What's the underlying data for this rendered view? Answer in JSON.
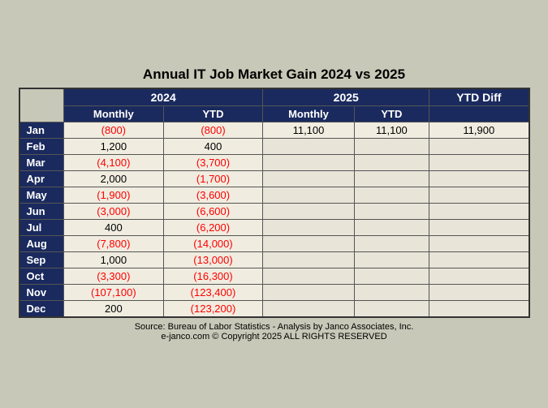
{
  "title": "Annual IT  Job Market  Gain 2024 vs 2025",
  "headers": {
    "year2024": "2024",
    "year2025": "2025",
    "monthly": "Monthly",
    "ytd": "YTD",
    "ytdDiff": "YTD Diff"
  },
  "rows": [
    {
      "month": "Jan",
      "m2024": "(800)",
      "ytd2024": "(800)",
      "m2024neg": true,
      "ytd2024neg": true,
      "m2025": "11,100",
      "ytd2025": "11,100",
      "m2025neg": false,
      "ytd2025neg": false,
      "ytdDiff": "11,900",
      "ytdDiffNeg": false,
      "has2025": true
    },
    {
      "month": "Feb",
      "m2024": "1,200",
      "ytd2024": "400",
      "m2024neg": false,
      "ytd2024neg": false,
      "m2025": "",
      "ytd2025": "",
      "m2025neg": false,
      "ytd2025neg": false,
      "ytdDiff": "",
      "ytdDiffNeg": false,
      "has2025": false
    },
    {
      "month": "Mar",
      "m2024": "(4,100)",
      "ytd2024": "(3,700)",
      "m2024neg": true,
      "ytd2024neg": true,
      "m2025": "",
      "ytd2025": "",
      "m2025neg": false,
      "ytd2025neg": false,
      "ytdDiff": "",
      "ytdDiffNeg": false,
      "has2025": false
    },
    {
      "month": "Apr",
      "m2024": "2,000",
      "ytd2024": "(1,700)",
      "m2024neg": false,
      "ytd2024neg": true,
      "m2025": "",
      "ytd2025": "",
      "m2025neg": false,
      "ytd2025neg": false,
      "ytdDiff": "",
      "ytdDiffNeg": false,
      "has2025": false
    },
    {
      "month": "May",
      "m2024": "(1,900)",
      "ytd2024": "(3,600)",
      "m2024neg": true,
      "ytd2024neg": true,
      "m2025": "",
      "ytd2025": "",
      "m2025neg": false,
      "ytd2025neg": false,
      "ytdDiff": "",
      "ytdDiffNeg": false,
      "has2025": false
    },
    {
      "month": "Jun",
      "m2024": "(3,000)",
      "ytd2024": "(6,600)",
      "m2024neg": true,
      "ytd2024neg": true,
      "m2025": "",
      "ytd2025": "",
      "m2025neg": false,
      "ytd2025neg": false,
      "ytdDiff": "",
      "ytdDiffNeg": false,
      "has2025": false
    },
    {
      "month": "Jul",
      "m2024": "400",
      "ytd2024": "(6,200)",
      "m2024neg": false,
      "ytd2024neg": true,
      "m2025": "",
      "ytd2025": "",
      "m2025neg": false,
      "ytd2025neg": false,
      "ytdDiff": "",
      "ytdDiffNeg": false,
      "has2025": false
    },
    {
      "month": "Aug",
      "m2024": "(7,800)",
      "ytd2024": "(14,000)",
      "m2024neg": true,
      "ytd2024neg": true,
      "m2025": "",
      "ytd2025": "",
      "m2025neg": false,
      "ytd2025neg": false,
      "ytdDiff": "",
      "ytdDiffNeg": false,
      "has2025": false
    },
    {
      "month": "Sep",
      "m2024": "1,000",
      "ytd2024": "(13,000)",
      "m2024neg": false,
      "ytd2024neg": true,
      "m2025": "",
      "ytd2025": "",
      "m2025neg": false,
      "ytd2025neg": false,
      "ytdDiff": "",
      "ytdDiffNeg": false,
      "has2025": false
    },
    {
      "month": "Oct",
      "m2024": "(3,300)",
      "ytd2024": "(16,300)",
      "m2024neg": true,
      "ytd2024neg": true,
      "m2025": "",
      "ytd2025": "",
      "m2025neg": false,
      "ytd2025neg": false,
      "ytdDiff": "",
      "ytdDiffNeg": false,
      "has2025": false
    },
    {
      "month": "Nov",
      "m2024": "(107,100)",
      "ytd2024": "(123,400)",
      "m2024neg": true,
      "ytd2024neg": true,
      "m2025": "",
      "ytd2025": "",
      "m2025neg": false,
      "ytd2025neg": false,
      "ytdDiff": "",
      "ytdDiffNeg": false,
      "has2025": false
    },
    {
      "month": "Dec",
      "m2024": "200",
      "ytd2024": "(123,200)",
      "m2024neg": false,
      "ytd2024neg": true,
      "m2025": "",
      "ytd2025": "",
      "m2025neg": false,
      "ytd2025neg": false,
      "ytdDiff": "",
      "ytdDiffNeg": false,
      "has2025": false
    }
  ],
  "footer": {
    "line1": "Source: Bureau of Labor Statistics - Analysis by Janco Associates, Inc.",
    "line2": "e-janco.com © Copyright 2025 ALL RIGHTS RESERVED"
  }
}
